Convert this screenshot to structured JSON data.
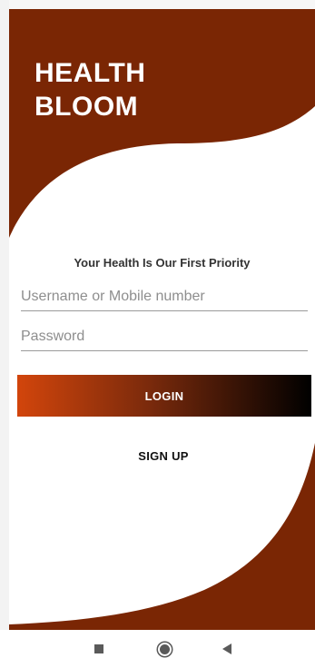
{
  "app": {
    "name_line1": "HEALTH",
    "name_line2": "BLOOM",
    "tagline": "Your Health Is Our First Priority"
  },
  "form": {
    "username_placeholder": "Username or Mobile number",
    "username_value": "",
    "password_placeholder": "Password",
    "password_value": "",
    "login_label": "LOGIN",
    "signup_label": "SIGN UP"
  },
  "colors": {
    "brand_brown": "#7a2604",
    "button_gradient_start": "#d2450c",
    "button_gradient_end": "#000000"
  },
  "nav": {
    "recents_icon": "square-recents-icon",
    "home_icon": "circle-home-icon",
    "back_icon": "triangle-back-icon"
  }
}
